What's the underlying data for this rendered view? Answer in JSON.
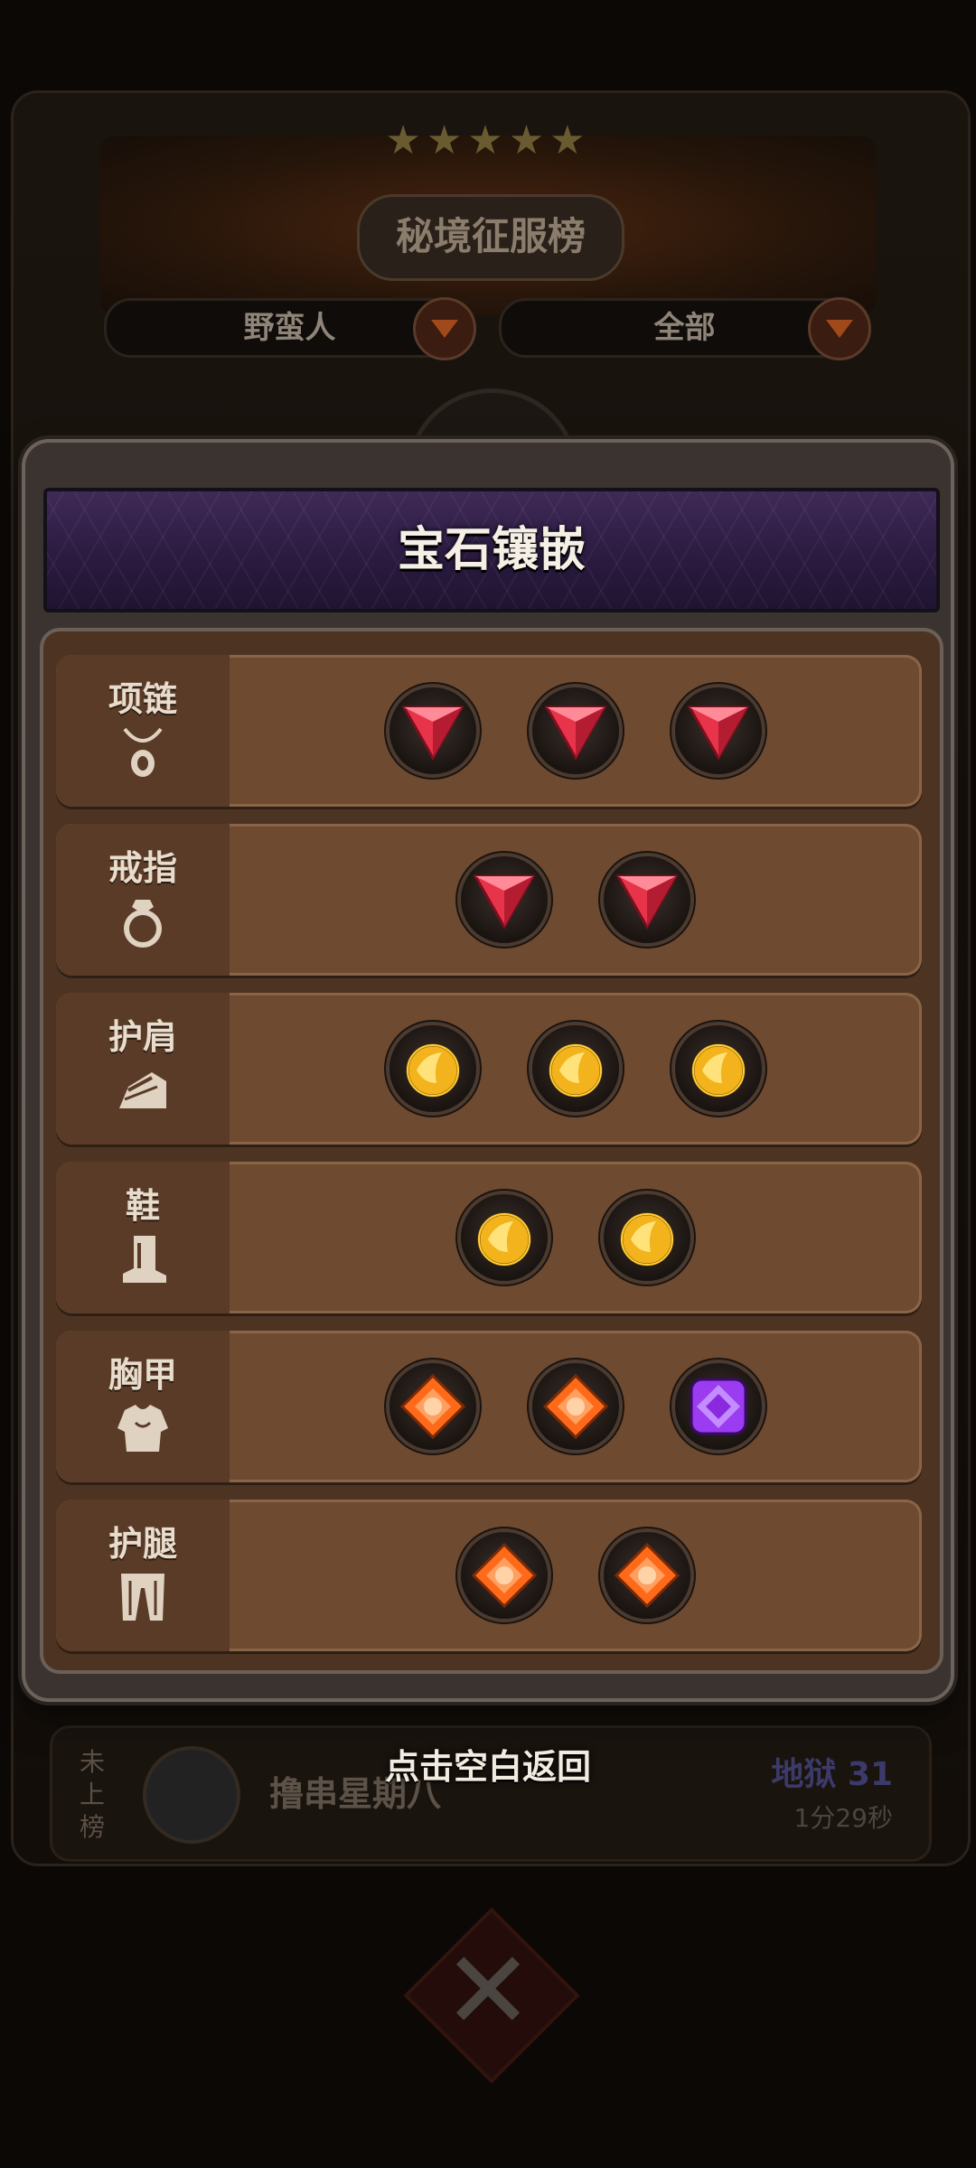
{
  "background": {
    "leaderboard_title": "秘境征服榜",
    "stars": "★★★★★",
    "class_filter": "野蛮人",
    "scope_filter": "全部",
    "my_rank": {
      "status": "未上榜",
      "player_name": "撸串星期八",
      "level": "地狱 31",
      "time": "1分29秒"
    }
  },
  "modal": {
    "title": "宝石镶嵌",
    "rows": [
      {
        "label": "项链",
        "icon": "necklace-icon",
        "gems": [
          "red-triangle",
          "red-triangle",
          "red-triangle"
        ]
      },
      {
        "label": "戒指",
        "icon": "ring-icon",
        "gems": [
          "red-triangle",
          "red-triangle"
        ]
      },
      {
        "label": "护肩",
        "icon": "shoulder-icon",
        "gems": [
          "gold-round",
          "gold-round",
          "gold-round"
        ]
      },
      {
        "label": "鞋",
        "icon": "boot-icon",
        "gems": [
          "gold-round",
          "gold-round"
        ]
      },
      {
        "label": "胸甲",
        "icon": "chest-armor-icon",
        "gems": [
          "orange-square",
          "orange-square",
          "purple-square"
        ]
      },
      {
        "label": "护腿",
        "icon": "leg-armor-icon",
        "gems": [
          "orange-square",
          "orange-square"
        ]
      }
    ]
  },
  "hint": "点击空白返回",
  "colors": {
    "gem_red": "#e8344a",
    "gem_gold": "#f2b31c",
    "gem_orange": "#ff6a1a",
    "gem_purple": "#9b3cf0",
    "modal_header": "#3a2754",
    "row_bg": "#6e4a31"
  }
}
